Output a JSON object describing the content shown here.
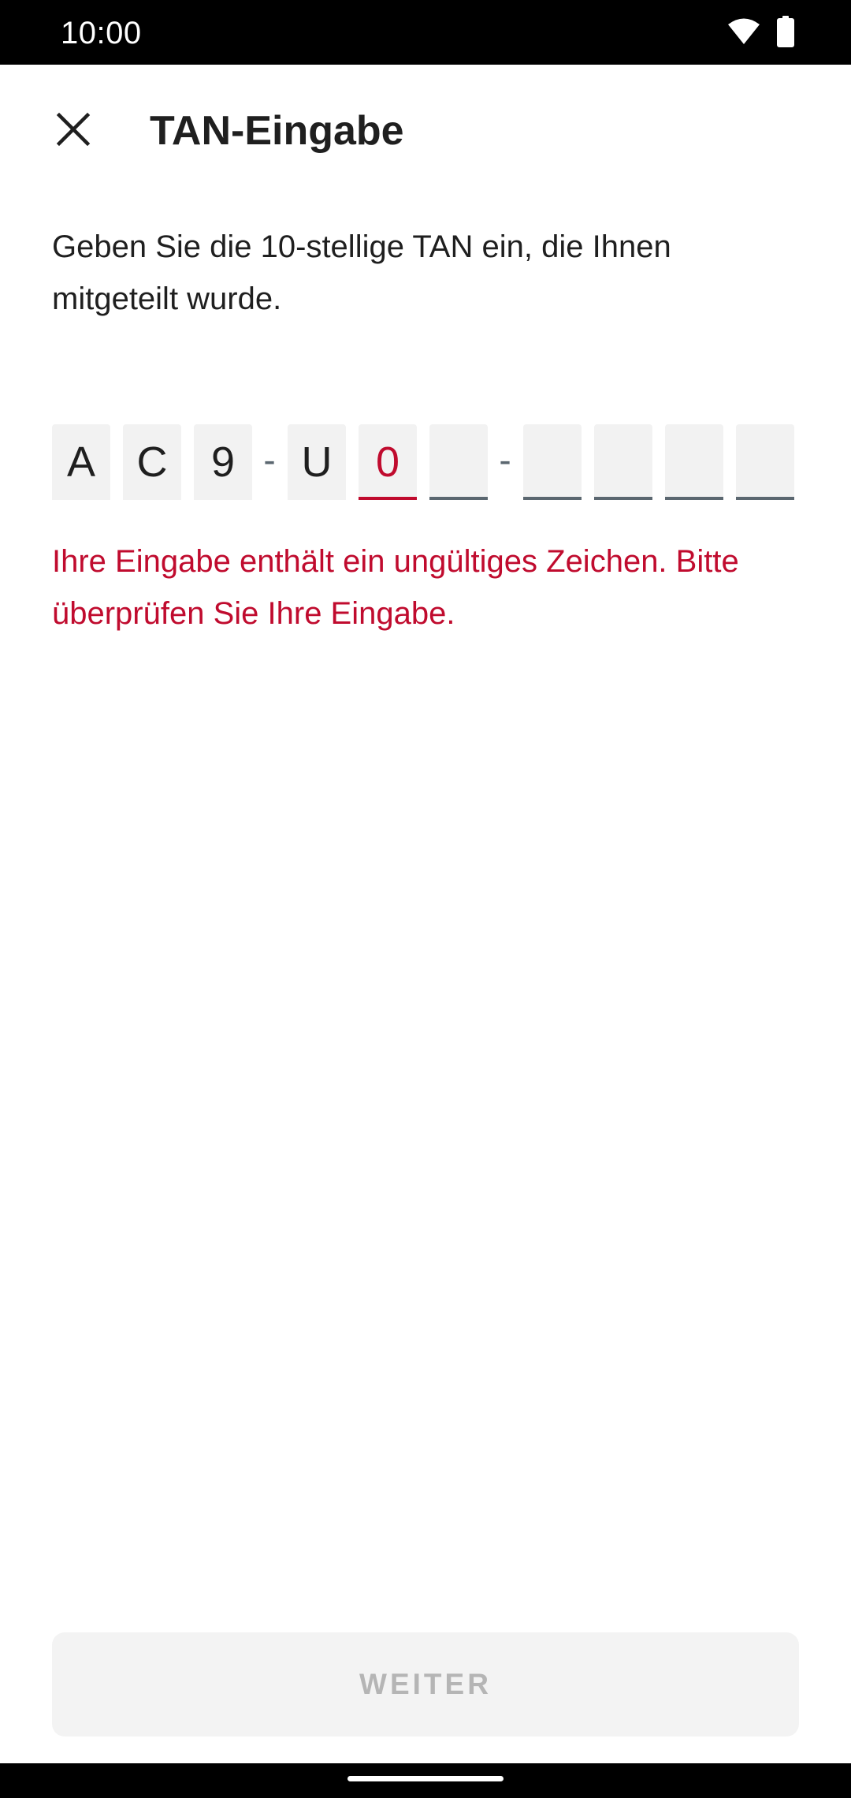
{
  "status_bar": {
    "time": "10:00",
    "icons": [
      "wifi-icon",
      "battery-icon"
    ]
  },
  "app_bar": {
    "close_icon": "close-icon",
    "title": "TAN-Eingabe"
  },
  "instructions": "Geben Sie die 10-stellige TAN ein, die Ihnen mitgeteilt wurde.",
  "tan": {
    "cells": [
      "A",
      "C",
      "9",
      "U",
      "0",
      "",
      "",
      "",
      "",
      ""
    ],
    "separator": "-",
    "invalid_cell_index": 4
  },
  "error_message": "Ihre Eingabe enthält ein ungültiges Zeichen. Bitte überprüfen Sie Ihre Eingabe.",
  "continue_button": {
    "label": "WEITER",
    "enabled": false
  },
  "colors": {
    "error": "#c00b2e",
    "text": "#1f1f1f",
    "field_background": "#f2f2f2",
    "field_underline": "#5b6770",
    "button_disabled_background": "#f3f3f3",
    "button_disabled_text": "#b5b5b5"
  }
}
